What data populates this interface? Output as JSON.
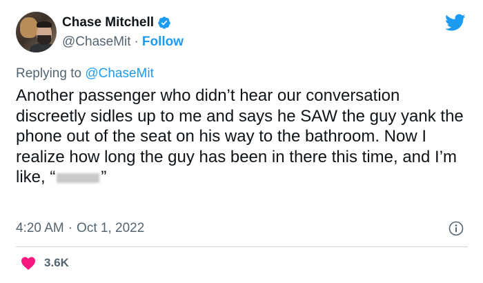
{
  "author": {
    "name": "Chase Mitchell",
    "handle": "@ChaseMit",
    "separator": "·",
    "follow_label": "Follow",
    "verified_icon": "verified-badge-icon"
  },
  "reply": {
    "prefix": "Replying to",
    "mention": "@ChaseMit"
  },
  "tweet": {
    "text_before": "Another passenger who didn’t hear our conversation discreetly sidles up to me and says he SAW the guy yank the phone out of the seat on his way to the bathroom. Now I realize how long the guy has been in there this time, and I’m like, “",
    "text_after": "”"
  },
  "meta": {
    "time": "4:20 AM",
    "separator": "·",
    "date": "Oct 1, 2022"
  },
  "stats": {
    "likes": "3.6K"
  },
  "colors": {
    "accent": "#1d9bf0",
    "heart": "#f91880",
    "muted": "#536471",
    "text": "#0f1419"
  },
  "icons": {
    "platform": "twitter-bird-icon",
    "info": "info-icon",
    "like": "heart-icon"
  }
}
